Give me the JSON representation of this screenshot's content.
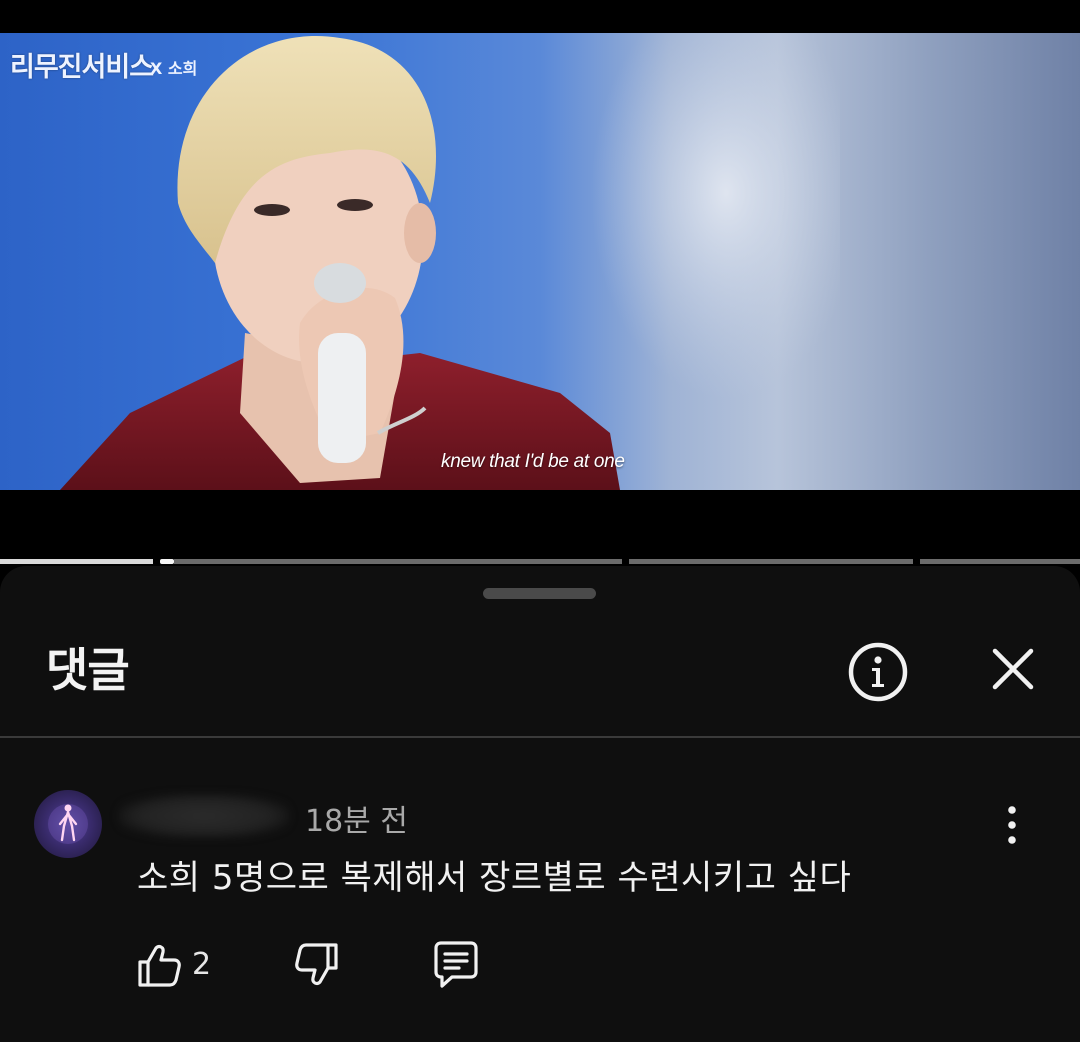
{
  "video": {
    "logo_text": "리무진서비스",
    "logo_sub": "X 소희",
    "subtitle": "knew that I'd be at one",
    "progress_fraction": 0.145
  },
  "comments_sheet": {
    "title": "댓글",
    "icons": {
      "info": "info-circle-icon",
      "close": "close-icon"
    }
  },
  "comment": {
    "time": "18분 전",
    "text": "소희 5명으로 복제해서 장르별로 수련시키고 싶다",
    "like_count": "2",
    "icons": {
      "more": "more-vertical-icon",
      "like": "thumbs-up-icon",
      "dislike": "thumbs-down-icon",
      "reply": "reply-comment-icon"
    }
  },
  "colors": {
    "sheet_background": "#0f0f0f",
    "text_primary": "#f1f1f1",
    "text_secondary": "#a9a9a9"
  }
}
